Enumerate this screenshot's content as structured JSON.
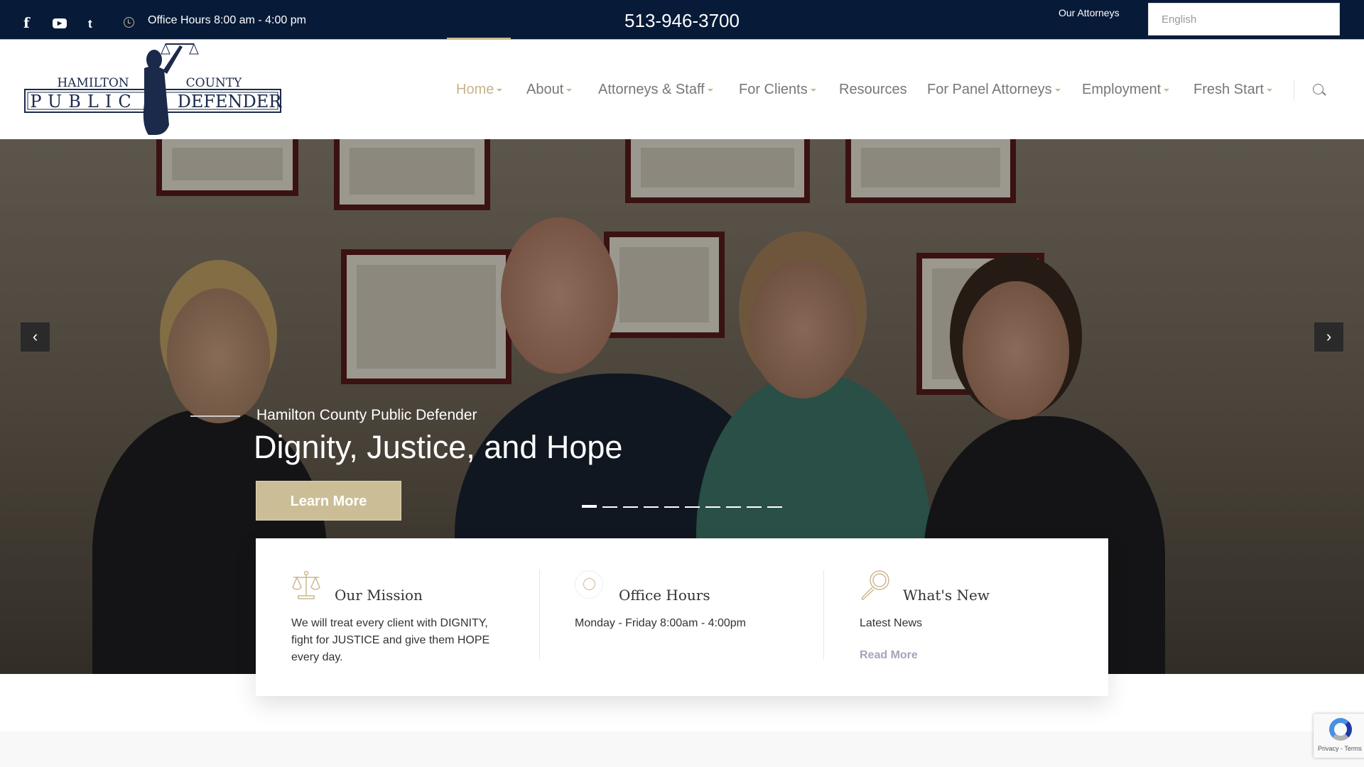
{
  "topbar": {
    "social": [
      {
        "icon": "facebook-icon",
        "glyph": "f"
      },
      {
        "icon": "youtube-icon",
        "glyph": "▶"
      },
      {
        "icon": "twitter-icon",
        "glyph": "t"
      }
    ],
    "office_hours": "Office Hours 8:00 am - 4:00 pm",
    "phone": "513-946-3700",
    "our_attorneys": "Our Attorneys",
    "language": "English"
  },
  "logo": {
    "line1_left": "HAMILTON",
    "line1_right": "COUNTY",
    "line2_left": "PUBLIC",
    "line2_right": "DEFENDER"
  },
  "nav": {
    "items": [
      {
        "label": "Home",
        "dropdown": true,
        "active": true
      },
      {
        "label": "About",
        "dropdown": true
      },
      {
        "label": "Attorneys & Staff",
        "dropdown": true
      },
      {
        "label": "For Clients",
        "dropdown": true
      },
      {
        "label": "Resources",
        "dropdown": false
      },
      {
        "label": "For Panel Attorneys",
        "dropdown": true
      },
      {
        "label": "Employment",
        "dropdown": true
      },
      {
        "label": "Fresh Start",
        "dropdown": true
      }
    ]
  },
  "hero": {
    "subtitle": "Hamilton County Public Defender",
    "title": "Dignity, Justice, and Hope",
    "button": "Learn More",
    "prev": "‹",
    "next": "›",
    "slide_count": 10,
    "active_slide": 1
  },
  "cards": [
    {
      "icon": "scales-icon",
      "title": "Our Mission",
      "text": "We will treat every client with DIGNITY, fight for JUSTICE and give them HOPE every day."
    },
    {
      "icon": "clock-icon",
      "title": "Office Hours",
      "text": "Monday - Friday 8:00am - 4:00pm"
    },
    {
      "icon": "magnifier-icon",
      "title": "What's New",
      "text": "Latest News",
      "link": "Read More"
    }
  ],
  "recaptcha": {
    "text": "Privacy - Terms"
  },
  "colors": {
    "navy": "#071a38",
    "gold": "#c9b98f",
    "button": "#cbbe97"
  }
}
